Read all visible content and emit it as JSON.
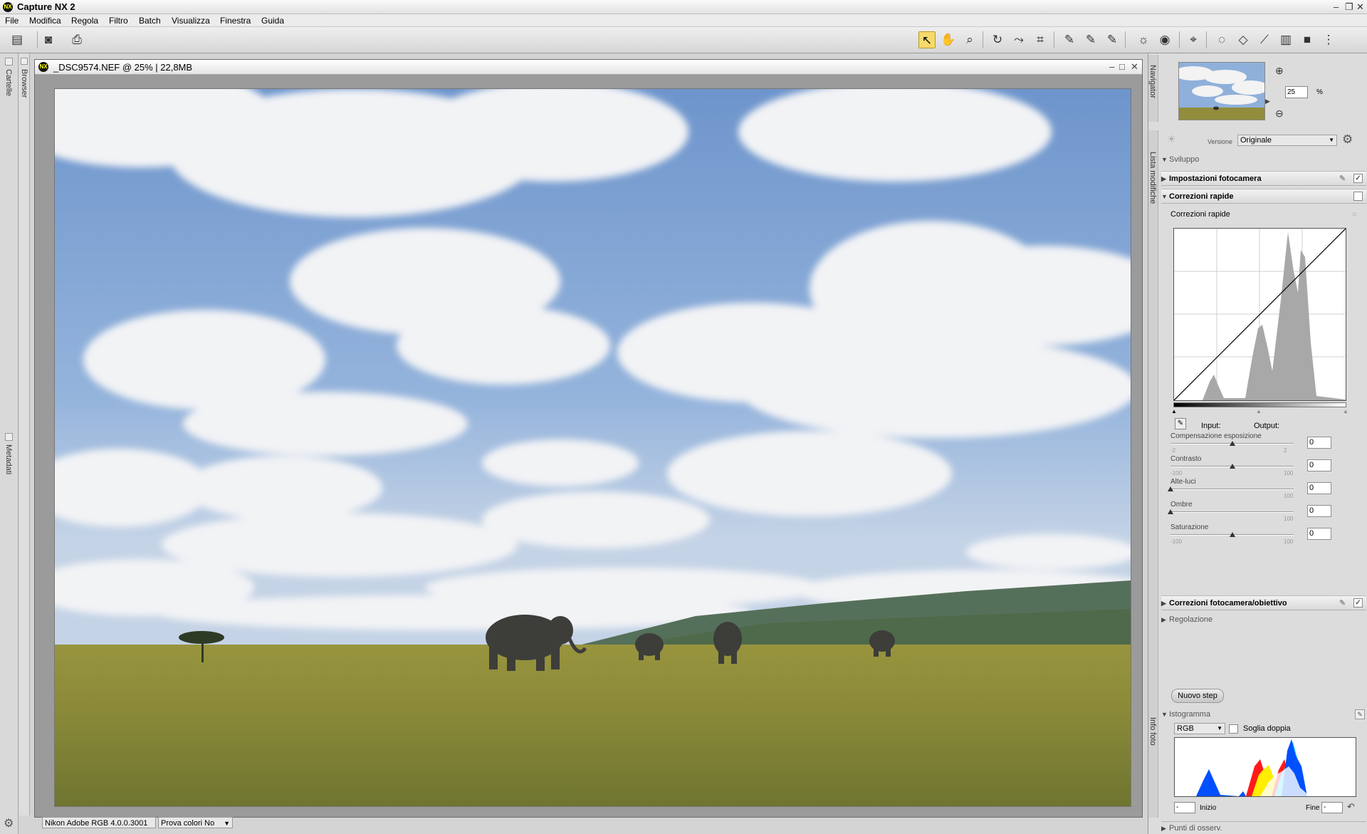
{
  "app": {
    "title": "Capture NX 2",
    "logo": "NX"
  },
  "window_controls": {
    "minimize": "–",
    "restore": "❐",
    "close": "✕"
  },
  "menu": [
    "File",
    "Modifica",
    "Regola",
    "Filtro",
    "Batch",
    "Visualizza",
    "Finestra",
    "Guida"
  ],
  "left_strips": {
    "folders": "Cartelle",
    "browser": "Browser",
    "metadata": "Metadati"
  },
  "document": {
    "title": "_DSC9574.NEF @ 25% | 22,8MB",
    "controls": {
      "minimize": "–",
      "maximize": "□",
      "close": "✕"
    }
  },
  "status": {
    "profile": "Nikon Adobe RGB 4.0.0.3001",
    "softproof": "Prova colori No"
  },
  "navigator": {
    "label": "Navigator",
    "zoom": "25",
    "zoom_unit": "%"
  },
  "edit_list": {
    "label": "Lista modifiche",
    "version_label": "Versione",
    "version_value": "Originale",
    "development": "Sviluppo",
    "camera_settings": "Impostazioni fotocamera",
    "quick_fix": "Correzioni rapide",
    "quick_fix_sub": "Correzioni rapide",
    "input_label": "Input:",
    "output_label": "Output:",
    "sliders": [
      {
        "label": "Compensazione esposizione",
        "min": "-2",
        "max": "2",
        "value": "0",
        "pos": 0.5
      },
      {
        "label": "Contrasto",
        "min": "-100",
        "max": "100",
        "value": "0",
        "pos": 0.5
      },
      {
        "label": "Alte-luci",
        "min": "",
        "max": "100",
        "value": "0",
        "pos": 0.0
      },
      {
        "label": "Ombre",
        "min": "",
        "max": "100",
        "value": "0",
        "pos": 0.0
      },
      {
        "label": "Saturazione",
        "min": "-100",
        "max": "100",
        "value": "0",
        "pos": 0.5
      }
    ],
    "camera_lens": "Correzioni fotocamera/obiettivo",
    "adjust": "Regolazione",
    "new_step": "Nuovo step"
  },
  "histogram": {
    "label": "Istogramma",
    "info_label": "Info foto",
    "channel": "RGB",
    "dual_threshold": "Soglia doppia",
    "start_label": "Inizio",
    "start_value": "-",
    "end_label": "Fine",
    "end_value": "-"
  },
  "watch_points": "Punti di osserv.",
  "colors": {
    "accent": "#f5d96b",
    "hist_blue": "#0050ff",
    "hist_red": "#ff1a1a",
    "hist_yellow": "#ffee00",
    "hist_cyan": "#33ddff"
  }
}
